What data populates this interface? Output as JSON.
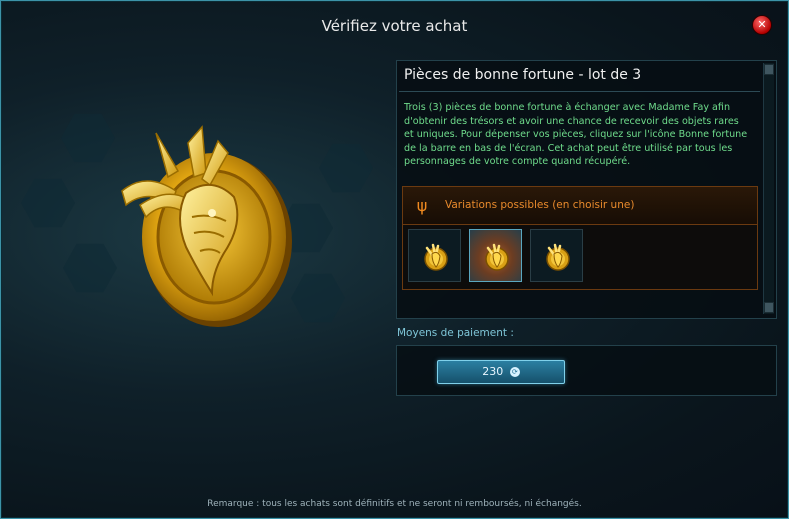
{
  "window": {
    "title": "Vérifiez votre achat"
  },
  "item": {
    "name": "Pièces de bonne fortune - lot de 3",
    "description": "Trois (3) pièces de bonne fortune à échanger avec Madame Fay afin d'obtenir des trésors et avoir une chance de recevoir des objets rares et uniques. Pour dépenser vos pièces, cliquez sur l'icône Bonne fortune de la barre en bas de l'écran. Cet achat peut être utilisé par tous les personnages de votre compte quand récupéré."
  },
  "variations": {
    "label": "Variations possibles (en choisir une)",
    "count": 3,
    "selected_index": 1
  },
  "payment": {
    "label": "Moyens de paiement :",
    "price": "230",
    "currency_icon": "currency-coin-icon"
  },
  "footer": {
    "note": "Remarque : tous les achats sont définitifs et ne seront ni remboursés, ni échangés."
  },
  "colors": {
    "accent": "#3c93a8",
    "description_text": "#6fdc8c",
    "variation_orange": "#e88a2c",
    "price_button": "#2b7fa2"
  }
}
